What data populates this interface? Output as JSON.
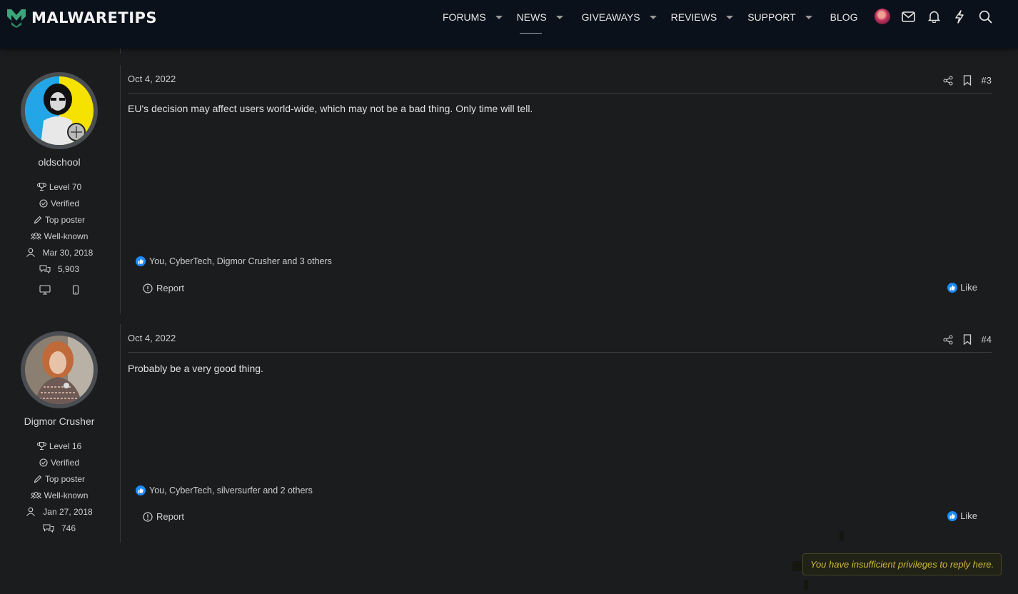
{
  "brand": {
    "name": "MALWARETIPS"
  },
  "nav": {
    "items": [
      {
        "label": "FORUMS",
        "has_menu": true
      },
      {
        "label": "NEWS",
        "has_menu": true,
        "active": true
      },
      {
        "label": "GIVEAWAYS",
        "has_menu": true
      },
      {
        "label": "REVIEWS",
        "has_menu": true
      },
      {
        "label": "SUPPORT",
        "has_menu": true
      },
      {
        "label": "BLOG",
        "has_menu": false
      }
    ],
    "icons": [
      "user-avatar",
      "envelope-icon",
      "bell-icon",
      "lightning-icon",
      "search-icon"
    ]
  },
  "posts": [
    {
      "username": "oldschool",
      "level": "Level 70",
      "verified": "Verified",
      "badge1": "Top poster",
      "badge2": "Well-known",
      "joined": "Mar 30, 2018",
      "messages": "5,903",
      "date": "Oct 4, 2022",
      "number": "#3",
      "body": "EU's decision may affect users world-wide, which may not be a bad thing. Only time will tell.",
      "reactions": "You, CyberTech, Digmor Crusher and 3 others",
      "report": "Report",
      "like": "Like"
    },
    {
      "username": "Digmor Crusher",
      "level": "Level 16",
      "verified": "Verified",
      "badge1": "Top poster",
      "badge2": "Well-known",
      "joined": "Jan 27, 2018",
      "messages": "746",
      "date": "Oct 4, 2022",
      "number": "#4",
      "body": "Probably be a very good thing.",
      "reactions": "You, CyberTech, silversurfer and 2 others",
      "report": "Report",
      "like": "Like"
    }
  ],
  "notice": "You have insufficient privileges to reply here.",
  "colors": {
    "accent": "#1a8cff",
    "notice_text": "#d1b93a",
    "header_bg": "#0a111a"
  }
}
